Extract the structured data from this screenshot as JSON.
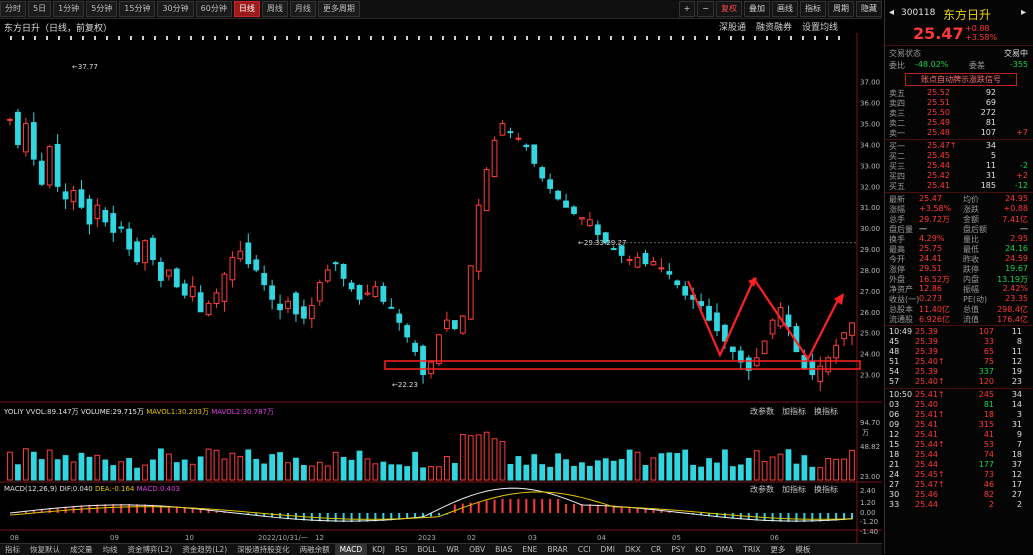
{
  "toolbar": {
    "periods": [
      "分时",
      "5日",
      "1分钟",
      "5分钟",
      "15分钟",
      "30分钟",
      "60分钟",
      "日线",
      "周线",
      "月线",
      "更多周期"
    ],
    "active_period": "日线",
    "right_buttons": [
      "+",
      "−",
      "复权",
      "叠加",
      "画线",
      "指标",
      "周期",
      "隐藏"
    ]
  },
  "title": "东方日升（日线，前复权）",
  "chart_links": [
    "深股通",
    "融资融券",
    "设置均线"
  ],
  "price_axis": [
    "37.00",
    "36.00",
    "35.00",
    "34.00",
    "33.00",
    "32.00",
    "31.00",
    "30.00",
    "29.00",
    "28.00",
    "27.00",
    "26.00",
    "25.00",
    "24.00",
    "23.00"
  ],
  "annotations": {
    "high": "37.77",
    "low": "22.23",
    "mid": "29.33-29.27"
  },
  "volume_legend": {
    "yolume_label": "YOLIY",
    "vol": "VVOL:89.147万",
    "volume": "VOLUME:29.715万",
    "ma5": "MAVOL1:30.203万",
    "ma10": "MAVOL2:30.787万"
  },
  "volume_axis": [
    "94.70",
    "48.82",
    "23.00"
  ],
  "volume_unit": "万",
  "panel_buttons": [
    "改参数",
    "加指标",
    "换指标"
  ],
  "macd_legend": {
    "name": "MACD(12,26,9)",
    "dif": "DIF:0.040",
    "dea": "DEA:-0.164",
    "macd": "MACD:0.403"
  },
  "macd_axis": [
    "2.40",
    "1.20",
    "0.00",
    "-1.20",
    "-1.40"
  ],
  "date_axis": [
    "08",
    "09",
    "10",
    "2022/10/31/一",
    "12",
    "2023",
    "02",
    "03",
    "04",
    "05",
    "06"
  ],
  "bottom_tabs": [
    "指标",
    "恢复默认",
    "成交量",
    "均线",
    "资金博弈(L2)",
    "资金趋势(L2)",
    "深股通持股变化",
    "两融余额",
    "MACD",
    "KDJ",
    "RSI",
    "BOLL",
    "WR",
    "OBV",
    "BIAS",
    "ENE",
    "BRAR",
    "CCI",
    "DMI",
    "DKX",
    "CR",
    "PSY",
    "KD",
    "DMA",
    "TRIX",
    "更多",
    "模板"
  ],
  "active_tab": "MACD",
  "chart_data": {
    "type": "candlestick",
    "symbol": "300118",
    "name": "东方日升",
    "ylim": [
      22.5,
      37.8
    ],
    "closes": [
      35.2,
      34.0,
      35.0,
      33.3,
      32.1,
      33.9,
      32.0,
      31.4,
      31.8,
      31.0,
      30.2,
      31.1,
      30.3,
      29.8,
      30.0,
      29.0,
      28.4,
      29.4,
      28.5,
      27.5,
      28.0,
      27.2,
      26.8,
      27.2,
      26.0,
      26.4,
      26.9,
      27.8,
      28.6,
      28.9,
      28.3,
      28.0,
      27.3,
      26.6,
      26.1,
      26.5,
      25.9,
      25.7,
      26.3,
      27.4,
      28.0,
      28.3,
      27.6,
      27.1,
      26.6,
      26.9,
      27.2,
      26.5,
      26.2,
      25.5,
      24.8,
      24.1,
      23.0,
      23.6,
      24.9,
      25.6,
      25.2,
      25.8,
      28.2,
      31.1,
      32.8,
      34.2,
      35.0,
      34.6,
      34.3,
      33.9,
      33.1,
      32.4,
      31.9,
      31.4,
      31.0,
      30.7,
      30.5,
      30.4,
      29.7,
      29.3,
      29.0,
      28.7,
      28.5,
      28.6,
      28.3,
      28.4,
      28.1,
      27.8,
      27.3,
      26.8,
      26.6,
      26.3,
      25.6,
      25.1,
      24.6,
      24.1,
      23.6,
      23.2,
      23.8,
      24.6,
      25.6,
      26.2,
      25.3,
      24.1,
      23.3,
      23.0,
      23.4,
      23.8,
      24.4,
      25.0,
      25.47
    ]
  },
  "quote": {
    "code": "300118",
    "name": "东方日升",
    "price": "25.47",
    "change": "+0.88",
    "change_pct": "+3.58%",
    "status_label": "交易状态",
    "status_value": "交易中",
    "weibi_label": "委比",
    "weibi": "-48.02%",
    "weicha_label": "委差",
    "weicha": "-355",
    "signal": "账点自动牌示涨跌信号",
    "asks": [
      [
        "卖五",
        "25.52",
        "92",
        ""
      ],
      [
        "卖四",
        "25.51",
        "69",
        ""
      ],
      [
        "卖三",
        "25.50",
        "272",
        ""
      ],
      [
        "卖二",
        "25.49",
        "81",
        ""
      ],
      [
        "卖一",
        "25.48",
        "107",
        "+7"
      ]
    ],
    "bids": [
      [
        "买一",
        "25.47↑",
        "34",
        ""
      ],
      [
        "买二",
        "25.45",
        "5",
        ""
      ],
      [
        "买三",
        "25.44",
        "11",
        "-2"
      ],
      [
        "买四",
        "25.42",
        "31",
        "+2"
      ],
      [
        "买五",
        "25.41",
        "185",
        "-12"
      ]
    ],
    "stats": [
      [
        "最新",
        "25.47",
        "均价",
        "24.95"
      ],
      [
        "涨幅",
        "+3.58%",
        "涨跌",
        "+0.88"
      ],
      [
        "总手",
        "29.72万",
        "金额",
        "7.41亿"
      ],
      [
        "盘后量",
        "一",
        "盘后额",
        "一"
      ],
      [
        "换手",
        "4.29%",
        "量比",
        "2.95"
      ],
      [
        "最高",
        "25.75",
        "最低",
        "24.16"
      ],
      [
        "今开",
        "24.41",
        "昨收",
        "24.59"
      ],
      [
        "涨停",
        "29.51",
        "跌停",
        "19.67"
      ],
      [
        "外盘",
        "16.52万",
        "内盘",
        "13.19万"
      ],
      [
        "净资产",
        "12.86",
        "振幅",
        "2.42%"
      ],
      [
        "收益(一)",
        "0.273",
        "PE(动)",
        "23.35"
      ],
      [
        "总股本",
        "11.40亿",
        "总值",
        "298.4亿"
      ],
      [
        "流通股",
        "6.926亿",
        "流值",
        "176.4亿"
      ]
    ],
    "ticks1": [
      [
        "10:49",
        "25.39",
        "107",
        "11"
      ],
      [
        "45",
        "25.39",
        "33",
        "8"
      ],
      [
        "48",
        "25.39",
        "65",
        "11"
      ],
      [
        "51",
        "25.40↑",
        "75",
        "12"
      ],
      [
        "54",
        "25.39",
        "337",
        "19"
      ],
      [
        "57",
        "25.40↑",
        "120",
        "23"
      ]
    ],
    "ticks2": [
      [
        "10:50",
        "25.41↑",
        "245",
        "34"
      ],
      [
        "03",
        "25.40",
        "81",
        "14"
      ],
      [
        "06",
        "25.41↑",
        "18",
        "3"
      ],
      [
        "09",
        "25.41",
        "315",
        "31"
      ],
      [
        "12",
        "25.41",
        "41",
        "9"
      ],
      [
        "15",
        "25.44↑",
        "53",
        "7"
      ],
      [
        "18",
        "25.44",
        "74",
        "18"
      ],
      [
        "21",
        "25.44",
        "177",
        "37"
      ],
      [
        "24",
        "25.45↑",
        "73",
        "12"
      ],
      [
        "27",
        "25.47↑",
        "46",
        "17"
      ],
      [
        "30",
        "25.46",
        "82",
        "27"
      ],
      [
        "33",
        "25.44",
        "2",
        "2"
      ]
    ],
    "side_labels": [
      "3",
      "2",
      "2",
      "2",
      "2",
      "2",
      "2",
      "2",
      "2",
      "2",
      "2",
      "2",
      "2",
      "2",
      "2",
      "2",
      "2",
      "2",
      "2",
      "2",
      "2",
      "2"
    ]
  }
}
